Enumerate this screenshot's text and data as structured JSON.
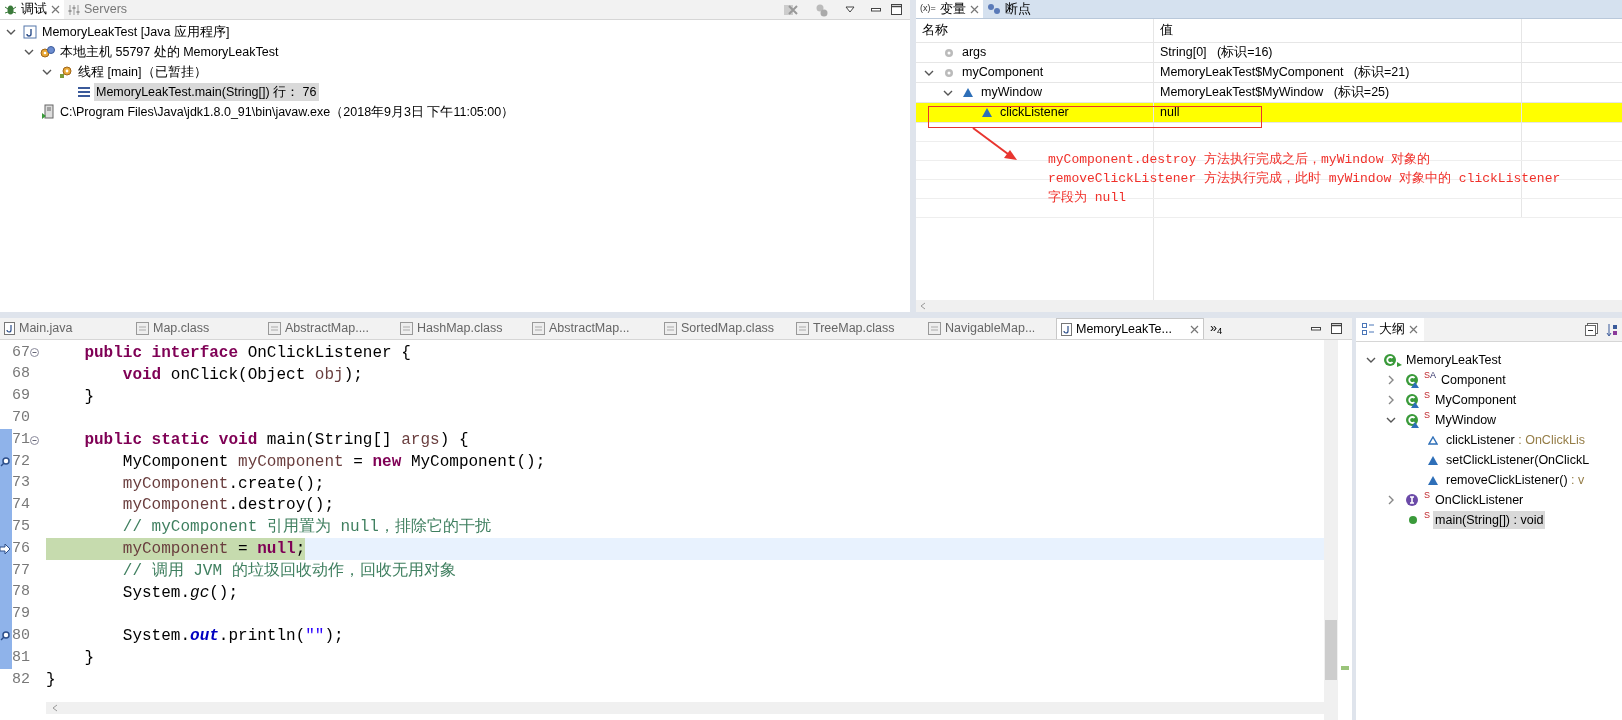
{
  "debug_view": {
    "tabs": [
      {
        "label": "调试",
        "selected": true,
        "kind": "debug"
      },
      {
        "label": "Servers",
        "selected": false,
        "kind": "servers"
      }
    ],
    "tree": [
      {
        "label": "MemoryLeakTest [Java 应用程序]",
        "kind": "launch",
        "expanded": true,
        "selected": false,
        "children": [
          {
            "label": "本地主机 55797 处的 MemoryLeakTest",
            "kind": "vm",
            "expanded": true,
            "selected": false,
            "children": [
              {
                "label": "线程 [main]（已暂挂）",
                "kind": "thread",
                "expanded": true,
                "selected": false,
                "children": [
                  {
                    "label": "MemoryLeakTest.main(String[]) 行： 76",
                    "kind": "frame",
                    "selected": true
                  }
                ]
              }
            ]
          },
          {
            "label": "C:\\Program Files\\Java\\jdk1.8.0_91\\bin\\javaw.exe（2018年9月3日 下午11:05:00）",
            "kind": "process",
            "selected": false
          }
        ]
      }
    ]
  },
  "variables_view": {
    "tabs": [
      {
        "label": "变量",
        "prefix": "(x)=",
        "selected": true
      },
      {
        "label": "断点",
        "selected": false
      }
    ],
    "columns": [
      "名称",
      "值"
    ],
    "rows": [
      {
        "name": "args",
        "value": "String[0]   (标识=16)",
        "kind": "local",
        "selected": false
      },
      {
        "name": "myComponent",
        "value": "MemoryLeakTest$MyComponent   (标识=21)",
        "kind": "local",
        "expanded": true,
        "selected": false,
        "children": [
          {
            "name": "myWindow",
            "value": "MemoryLeakTest$MyWindow   (标识=25)",
            "kind": "field",
            "expanded": true,
            "selected": false,
            "children": [
              {
                "name": "clickListener",
                "value": "null",
                "kind": "field",
                "selected": true
              }
            ]
          }
        ]
      }
    ],
    "annotation": "myComponent.destroy 方法执行完成之后，myWindow 对象的\nremoveClickListener 方法执行完成，此时 myWindow 对象中的 clickListener\n字段为 null"
  },
  "editor": {
    "tabs": [
      {
        "label": "Main.java",
        "kind": "java",
        "selected": false
      },
      {
        "label": "Map.class",
        "kind": "class",
        "selected": false
      },
      {
        "label": "AbstractMap....",
        "kind": "class",
        "selected": false
      },
      {
        "label": "HashMap.class",
        "kind": "class",
        "selected": false
      },
      {
        "label": "AbstractMap...",
        "kind": "class",
        "selected": false
      },
      {
        "label": "SortedMap.class",
        "kind": "class",
        "selected": false
      },
      {
        "label": "TreeMap.class",
        "kind": "class",
        "selected": false
      },
      {
        "label": "NavigableMap...",
        "kind": "class",
        "selected": false
      },
      {
        "label": "MemoryLeakTe...",
        "kind": "java",
        "selected": true
      }
    ],
    "overflow": "»$_{4}$",
    "lines": [
      {
        "number": "67",
        "in_range": false,
        "fold": true,
        "tokens": [
          {
            "kind": "keyword",
            "text": "    public interface"
          },
          {
            "kind": "plain",
            "text": " OnClickListener {"
          }
        ]
      },
      {
        "number": "68",
        "in_range": false,
        "tokens": [
          {
            "kind": "keyword",
            "text": "        void"
          },
          {
            "kind": "plain",
            "text": " onClick(Object "
          },
          {
            "kind": "local",
            "text": "obj"
          },
          {
            "kind": "plain",
            "text": ");"
          }
        ]
      },
      {
        "number": "69",
        "in_range": false,
        "tokens": [
          {
            "kind": "plain",
            "text": "    }"
          }
        ]
      },
      {
        "number": "70",
        "in_range": false
      },
      {
        "number": "71",
        "in_range": true,
        "fold": true,
        "tokens": [
          {
            "kind": "keyword",
            "text": "    public static void"
          },
          {
            "kind": "plain",
            "text": " main(String[] "
          },
          {
            "kind": "local",
            "text": "args"
          },
          {
            "kind": "plain",
            "text": ") {"
          }
        ]
      },
      {
        "number": "72",
        "in_range": true,
        "breakpoint": true,
        "tokens": [
          {
            "kind": "plain",
            "text": "        MyComponent "
          },
          {
            "kind": "local",
            "text": "myComponent"
          },
          {
            "kind": "plain",
            "text": " = "
          },
          {
            "kind": "keyword",
            "text": "new"
          },
          {
            "kind": "plain",
            "text": " MyComponent();"
          }
        ]
      },
      {
        "number": "73",
        "in_range": true,
        "tokens": [
          {
            "kind": "local",
            "text": "        myComponent"
          },
          {
            "kind": "plain",
            "text": ".create();"
          }
        ]
      },
      {
        "number": "74",
        "in_range": true,
        "tokens": [
          {
            "kind": "local",
            "text": "        myComponent"
          },
          {
            "kind": "plain",
            "text": ".destroy();"
          }
        ]
      },
      {
        "number": "75",
        "in_range": true,
        "tokens": [
          {
            "kind": "comment",
            "text": "        // myComponent 引用置为 null，排除它的干扰"
          }
        ]
      },
      {
        "number": "76",
        "in_range": true,
        "current": true,
        "tokens": [
          {
            "kind": "local",
            "text": "        myComponent"
          },
          {
            "kind": "plain",
            "text": " = "
          },
          {
            "kind": "keyword",
            "text": "null"
          },
          {
            "kind": "plain",
            "text": ";"
          }
        ]
      },
      {
        "number": "77",
        "in_range": true,
        "tokens": [
          {
            "kind": "comment",
            "text": "        // 调用 JVM 的垃圾回收动作，回收无用对象"
          }
        ]
      },
      {
        "number": "78",
        "in_range": true,
        "tokens": [
          {
            "kind": "plain",
            "text": "        System."
          },
          {
            "kind": "static_method",
            "text": "gc"
          },
          {
            "kind": "plain",
            "text": "();"
          }
        ]
      },
      {
        "number": "79",
        "in_range": true
      },
      {
        "number": "80",
        "in_range": true,
        "breakpoint": true,
        "tokens": [
          {
            "kind": "plain",
            "text": "        System."
          },
          {
            "kind": "static_field",
            "text": "out"
          },
          {
            "kind": "plain",
            "text": ".println("
          },
          {
            "kind": "string",
            "text": "\"\""
          },
          {
            "kind": "plain",
            "text": ");"
          }
        ]
      },
      {
        "number": "81",
        "in_range": true,
        "tokens": [
          {
            "kind": "plain",
            "text": "    }"
          }
        ]
      },
      {
        "number": "82",
        "in_range": false,
        "tokens": [
          {
            "kind": "plain",
            "text": "}"
          }
        ]
      }
    ]
  },
  "outline": {
    "title": "大纲",
    "tree": [
      {
        "name": "MemoryLeakTest",
        "kind": "class",
        "expanded": true,
        "selected": false,
        "children": [
          {
            "name": "Component",
            "kind": "inner_class",
            "modifiers": [
              "S",
              "A"
            ],
            "expanded": false,
            "selected": false
          },
          {
            "name": "MyComponent",
            "kind": "inner_class",
            "modifiers": [
              "S"
            ],
            "expanded": false,
            "selected": false
          },
          {
            "name": "MyWindow",
            "kind": "inner_class",
            "modifiers": [
              "S"
            ],
            "expanded": true,
            "selected": false,
            "children": [
              {
                "name": "clickListener",
                "detail": " : OnClickLis",
                "kind": "field",
                "selected": false
              },
              {
                "name": "setClickListener(OnClickL",
                "kind": "method",
                "selected": false
              },
              {
                "name": "removeClickListener()",
                "detail": " : v",
                "kind": "method",
                "selected": false
              }
            ]
          },
          {
            "name": "OnClickListener",
            "kind": "interface",
            "modifiers": [
              "S"
            ],
            "expanded": false,
            "selected": false
          },
          {
            "name": "main(String[]) : void",
            "kind": "public_method",
            "modifiers": [
              "S"
            ],
            "selected": true
          }
        ]
      }
    ]
  }
}
